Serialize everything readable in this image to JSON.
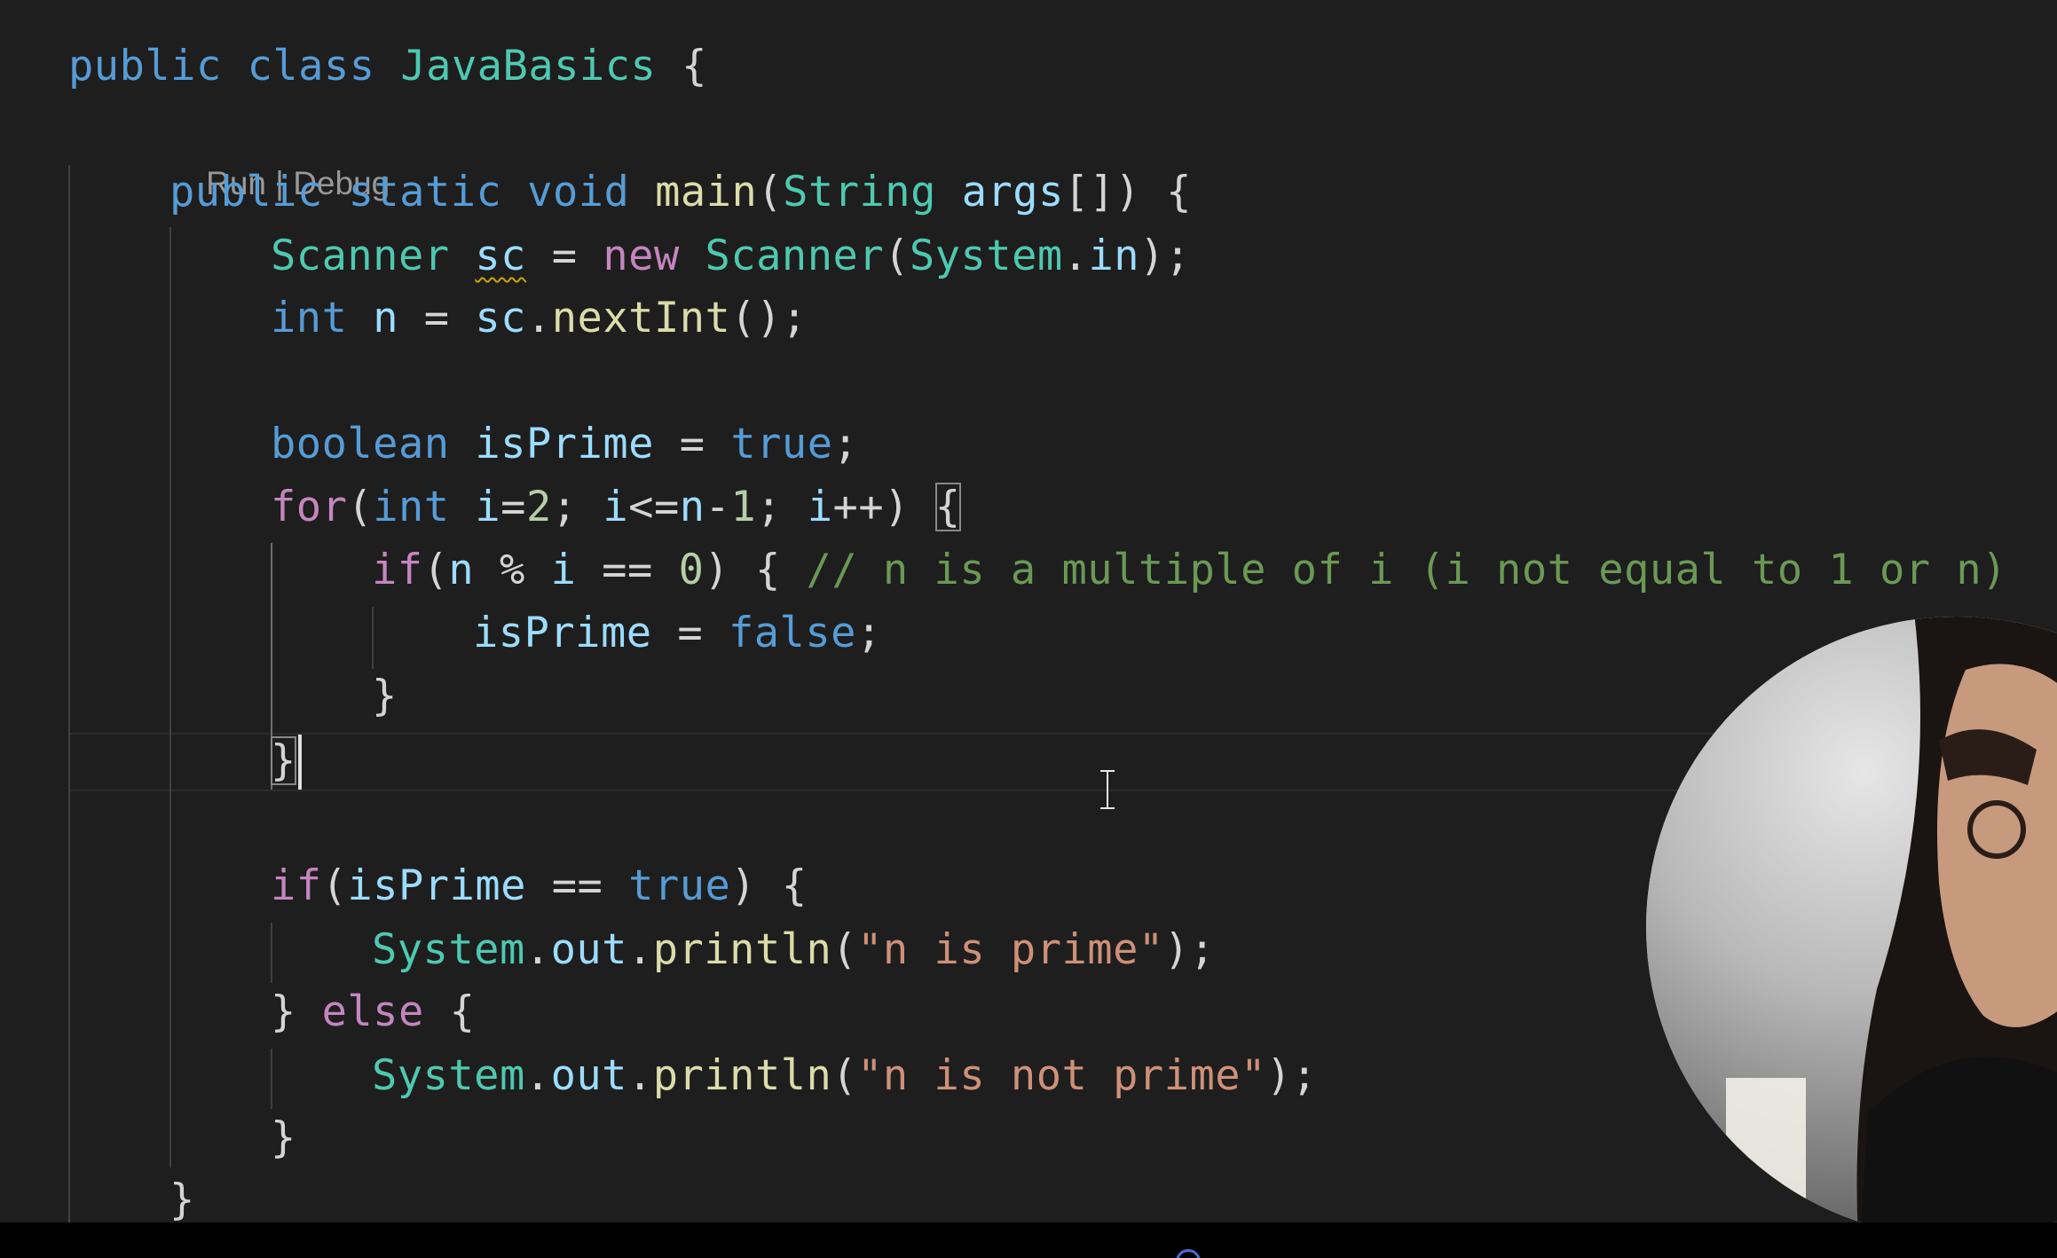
{
  "editor": {
    "codelens": {
      "run": "Run",
      "separator": " | ",
      "debug": "Debug"
    },
    "lines": [
      {
        "id": "l1",
        "tokens": [
          [
            "kw",
            "public"
          ],
          [
            "pun",
            " "
          ],
          [
            "kw",
            "class"
          ],
          [
            "pun",
            " "
          ],
          [
            "ty",
            "JavaBasics"
          ],
          [
            "pun",
            " {"
          ]
        ]
      },
      {
        "id": "l2",
        "tokens": [
          [
            "kw",
            "public"
          ],
          [
            "pun",
            " "
          ],
          [
            "kw",
            "static"
          ],
          [
            "pun",
            " "
          ],
          [
            "kw",
            "void"
          ],
          [
            "pun",
            " "
          ],
          [
            "fn",
            "main"
          ],
          [
            "pun",
            "("
          ],
          [
            "ty",
            "String"
          ],
          [
            "pun",
            " "
          ],
          [
            "var",
            "args"
          ],
          [
            "pun",
            "[]) {"
          ]
        ]
      },
      {
        "id": "l3",
        "tokens": [
          [
            "ty",
            "Scanner"
          ],
          [
            "pun",
            " "
          ],
          [
            "var squiggle",
            "sc"
          ],
          [
            "pun",
            " = "
          ],
          [
            "ctl",
            "new"
          ],
          [
            "pun",
            " "
          ],
          [
            "ty",
            "Scanner"
          ],
          [
            "pun",
            "("
          ],
          [
            "ty",
            "System"
          ],
          [
            "pun",
            "."
          ],
          [
            "var",
            "in"
          ],
          [
            "pun",
            ");"
          ]
        ]
      },
      {
        "id": "l4",
        "tokens": [
          [
            "kw",
            "int"
          ],
          [
            "pun",
            " "
          ],
          [
            "var",
            "n"
          ],
          [
            "pun",
            " = "
          ],
          [
            "var",
            "sc"
          ],
          [
            "pun",
            "."
          ],
          [
            "fn",
            "nextInt"
          ],
          [
            "pun",
            "();"
          ]
        ]
      },
      {
        "id": "l5",
        "tokens": []
      },
      {
        "id": "l6",
        "tokens": [
          [
            "kw",
            "boolean"
          ],
          [
            "pun",
            " "
          ],
          [
            "var",
            "isPrime"
          ],
          [
            "pun",
            " = "
          ],
          [
            "kw",
            "true"
          ],
          [
            "pun",
            ";"
          ]
        ]
      },
      {
        "id": "l7",
        "tokens": [
          [
            "ctl",
            "for"
          ],
          [
            "pun",
            "("
          ],
          [
            "kw",
            "int"
          ],
          [
            "pun",
            " "
          ],
          [
            "var",
            "i"
          ],
          [
            "pun",
            "="
          ],
          [
            "num",
            "2"
          ],
          [
            "pun",
            "; "
          ],
          [
            "var",
            "i"
          ],
          [
            "pun",
            "<="
          ],
          [
            "var",
            "n"
          ],
          [
            "pun",
            "-"
          ],
          [
            "num",
            "1"
          ],
          [
            "pun",
            "; "
          ],
          [
            "var",
            "i"
          ],
          [
            "pun",
            "++) "
          ],
          [
            "pun bracket-hl",
            "{"
          ]
        ]
      },
      {
        "id": "l8",
        "tokens": [
          [
            "ctl",
            "if"
          ],
          [
            "pun",
            "("
          ],
          [
            "var",
            "n"
          ],
          [
            "pun",
            " % "
          ],
          [
            "var",
            "i"
          ],
          [
            "pun",
            " == "
          ],
          [
            "num",
            "0"
          ],
          [
            "pun",
            ") { "
          ],
          [
            "com",
            "// n is a multiple of i (i not equal to 1 or n)"
          ]
        ]
      },
      {
        "id": "l9",
        "tokens": [
          [
            "var",
            "isPrime"
          ],
          [
            "pun",
            " = "
          ],
          [
            "kw",
            "false"
          ],
          [
            "pun",
            ";"
          ]
        ]
      },
      {
        "id": "l10",
        "tokens": [
          [
            "pun",
            "}"
          ]
        ]
      },
      {
        "id": "l11",
        "tokens": [
          [
            "pun bracket-hl",
            "}"
          ]
        ]
      },
      {
        "id": "l12",
        "tokens": []
      },
      {
        "id": "l13",
        "tokens": [
          [
            "ctl",
            "if"
          ],
          [
            "pun",
            "("
          ],
          [
            "var",
            "isPrime"
          ],
          [
            "pun",
            " == "
          ],
          [
            "kw",
            "true"
          ],
          [
            "pun",
            ") {"
          ]
        ]
      },
      {
        "id": "l14",
        "tokens": [
          [
            "ty",
            "System"
          ],
          [
            "pun",
            "."
          ],
          [
            "var",
            "out"
          ],
          [
            "pun",
            "."
          ],
          [
            "fn",
            "println"
          ],
          [
            "pun",
            "("
          ],
          [
            "str",
            "\"n is prime\""
          ],
          [
            "pun",
            ");"
          ]
        ]
      },
      {
        "id": "l15",
        "tokens": [
          [
            "pun",
            "} "
          ],
          [
            "ctl",
            "else"
          ],
          [
            "pun",
            " {"
          ]
        ]
      },
      {
        "id": "l16",
        "tokens": [
          [
            "ty",
            "System"
          ],
          [
            "pun",
            "."
          ],
          [
            "var",
            "out"
          ],
          [
            "pun",
            "."
          ],
          [
            "fn",
            "println"
          ],
          [
            "pun",
            "("
          ],
          [
            "str",
            "\"n is not prime\""
          ],
          [
            "pun",
            ");"
          ]
        ]
      },
      {
        "id": "l17",
        "tokens": [
          [
            "pun",
            "}"
          ]
        ]
      },
      {
        "id": "l18",
        "tokens": [
          [
            "pun",
            "}"
          ]
        ]
      }
    ]
  },
  "overlay": {
    "webcam_icon": "person-video-thumbnail",
    "cursor_icon": "text-cursor-icon"
  }
}
